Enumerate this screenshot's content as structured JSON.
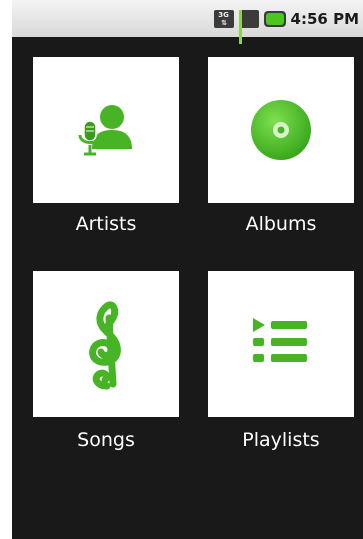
{
  "status_bar": {
    "network_type": "3G",
    "time": "4:56 PM"
  },
  "colors": {
    "accent": "#46b424",
    "background": "#191919",
    "tile": "#ffffff"
  },
  "tiles": [
    {
      "label": "Artists",
      "icon": "microphone-person-icon"
    },
    {
      "label": "Albums",
      "icon": "disc-icon"
    },
    {
      "label": "Songs",
      "icon": "treble-clef-icon"
    },
    {
      "label": "Playlists",
      "icon": "playlist-icon"
    }
  ]
}
